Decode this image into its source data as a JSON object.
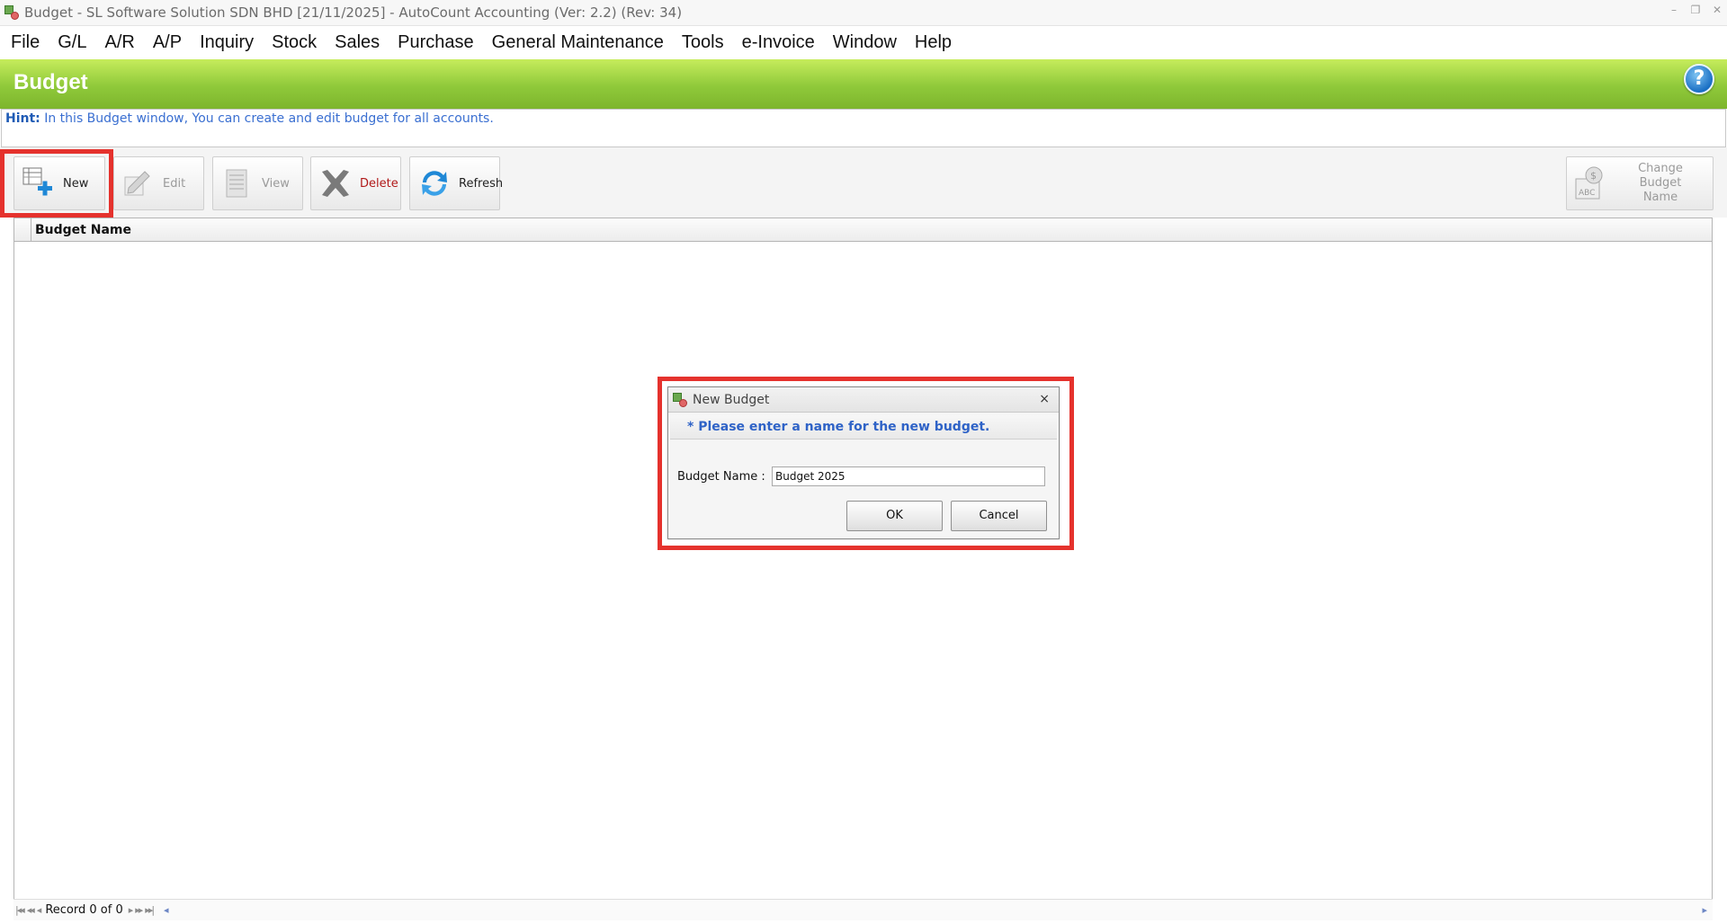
{
  "window": {
    "title": "Budget - SL Software Solution SDN BHD [21/11/2025] - AutoCount Accounting (Ver: 2.2) (Rev: 34)",
    "controls": [
      "–",
      "❐",
      "✕"
    ]
  },
  "menu": [
    {
      "label": "File"
    },
    {
      "label": "G/L"
    },
    {
      "label": "A/R"
    },
    {
      "label": "A/P"
    },
    {
      "label": "Inquiry"
    },
    {
      "label": "Stock"
    },
    {
      "label": "Sales"
    },
    {
      "label": "Purchase"
    },
    {
      "label": "General Maintenance"
    },
    {
      "label": "Tools"
    },
    {
      "label": "e-Invoice"
    },
    {
      "label": "Window"
    },
    {
      "label": "Help"
    }
  ],
  "header": {
    "title": "Budget",
    "help_glyph": "?"
  },
  "hint": {
    "label": "Hint:",
    "text": "In this Budget window, You can create and edit budget for all accounts."
  },
  "toolbar": {
    "new_label": "New",
    "edit_label": "Edit",
    "view_label": "View",
    "delete_label": "Delete",
    "refresh_label": "Refresh",
    "change_label_line1": "Change Budget",
    "change_label_line2": "Name"
  },
  "grid": {
    "columns": [
      "Budget Name"
    ],
    "rows": []
  },
  "navigator": {
    "record_text": "Record 0 of 0"
  },
  "dialog": {
    "title": "New Budget",
    "close_glyph": "×",
    "note": "* Please enter a name for the new budget.",
    "field_label": "Budget Name :",
    "field_value": "Budget 2025",
    "ok_label": "OK",
    "cancel_label": "Cancel"
  },
  "colors": {
    "header_green": "#8fc93a",
    "highlight_red": "#e5322d",
    "hint_blue": "#3a6fd1"
  }
}
